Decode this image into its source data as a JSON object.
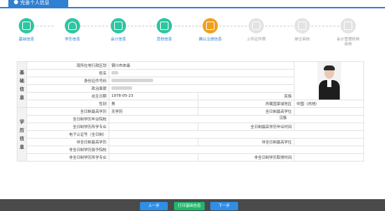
{
  "header": {
    "title": "完善个人信息"
  },
  "steps": [
    {
      "label": "基础信息",
      "state": "done",
      "icon": "id-card-icon"
    },
    {
      "label": "学历信息",
      "state": "done",
      "icon": "graduation-cap-icon"
    },
    {
      "label": "会计信息",
      "state": "done",
      "icon": "calculator-icon"
    },
    {
      "label": "其他信息",
      "state": "done",
      "icon": "document-icon"
    },
    {
      "label": "确认注册信息",
      "state": "current",
      "icon": "checklist-icon"
    },
    {
      "label": "上传证件照",
      "state": "pending",
      "icon": "camera-icon"
    },
    {
      "label": "单位审核",
      "state": "pending",
      "icon": "edit-icon"
    },
    {
      "label": "会计管理机构审核",
      "state": "pending",
      "icon": "monitor-icon"
    }
  ],
  "basic": {
    "section": "基础信息",
    "region_label": "现所在地行政区划",
    "region_value": "铜川市本级",
    "name_label": "姓名",
    "id_label": "身份证件号码",
    "politics_label": "政治面貌",
    "birth_label": "出生日期",
    "birth_value": "1978-05-23",
    "ethnicity_label": "民族",
    "ethnicity_value": "汉族",
    "gender_label": "性别",
    "gender_value": "男",
    "country_label": "所属国家或地区",
    "country_value": "中国（内地）"
  },
  "education": {
    "section": "学历信息",
    "ft_highest_edu_label": "全日制最高学历",
    "ft_highest_edu_value": "无学历",
    "ft_highest_degree_label": "全日制最高学位",
    "ft_school_label": "全日制学历毕业院校",
    "ft_major_label": "全日制学历所学专业",
    "ft_grad_time_label": "全日制最高学历毕业时间",
    "e_cert_label": "电子认证号（全日制）",
    "pt_highest_edu_label": "非全日制最高学历",
    "pt_highest_degree_label": "非全日制最高学位",
    "pt_school_label": "非全日制学历授予院校",
    "pt_major_label": "非全日制学历所学专业",
    "pt_time_label": "非全日制学历取得时间"
  },
  "footer": {
    "prev_label": "上一步",
    "print_label": "打印基础信息",
    "next_label": "下一步"
  }
}
